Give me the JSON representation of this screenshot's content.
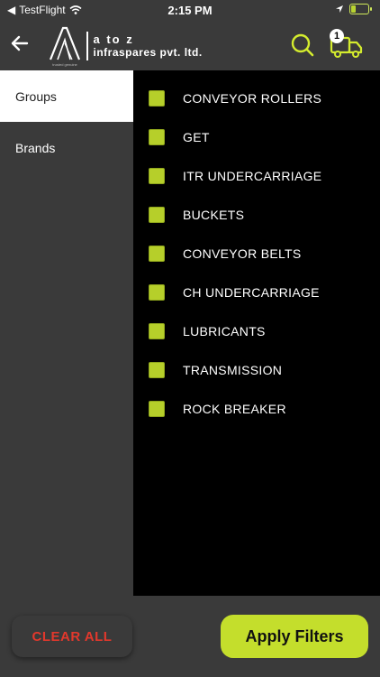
{
  "status_bar": {
    "carrier": "TestFlight",
    "time": "2:15 PM"
  },
  "header": {
    "logo_line1": "a to z",
    "logo_line2": "infraspares pvt. ltd.",
    "logo_tagline": "trusted genuine",
    "cart_count": "1"
  },
  "sidebar": {
    "items": [
      {
        "label": "Groups",
        "active": true
      },
      {
        "label": "Brands",
        "active": false
      }
    ]
  },
  "groups": [
    {
      "label": "CONVEYOR ROLLERS"
    },
    {
      "label": "GET"
    },
    {
      "label": "ITR UNDERCARRIAGE"
    },
    {
      "label": "BUCKETS"
    },
    {
      "label": "CONVEYOR BELTS"
    },
    {
      "label": "CH UNDERCARRIAGE"
    },
    {
      "label": "LUBRICANTS"
    },
    {
      "label": "TRANSMISSION"
    },
    {
      "label": "ROCK BREAKER"
    }
  ],
  "footer": {
    "clear_label": "CLEAR ALL",
    "apply_label": "Apply Filters"
  },
  "colors": {
    "accent": "#c4de2c",
    "danger": "#e2382c",
    "panel_bg": "#000000",
    "sidebar_bg": "#3a3a3a"
  }
}
